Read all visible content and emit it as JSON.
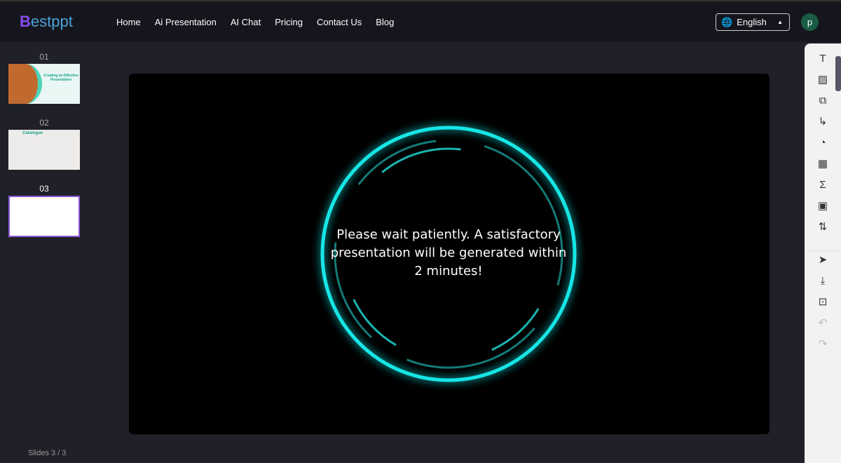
{
  "header": {
    "logo": "Bestppt",
    "logo_mark": "B",
    "logo_rest": "estppt",
    "nav": [
      "Home",
      "Ai Presentation",
      "AI Chat",
      "Pricing",
      "Contact Us",
      "Blog"
    ],
    "language": "English",
    "avatar_letter": "p"
  },
  "slides": [
    {
      "number": "01",
      "title": "Creating an Effective Presentation"
    },
    {
      "number": "02",
      "title": "Catalogue"
    },
    {
      "number": "03",
      "title": ""
    }
  ],
  "slide_count": "Slides 3 / 3",
  "loading": {
    "message": "Please wait patiently. A satisfactory presentation will be generated within 2 minutes!",
    "accent": "#19e6e6"
  },
  "toolbar": [
    "text-icon",
    "image-icon",
    "shape-icon",
    "connector-icon",
    "chart-icon",
    "table-icon",
    "formula-icon",
    "video-icon",
    "swap-icon",
    "pointer-icon",
    "download-icon",
    "present-icon",
    "undo-icon",
    "redo-icon"
  ]
}
